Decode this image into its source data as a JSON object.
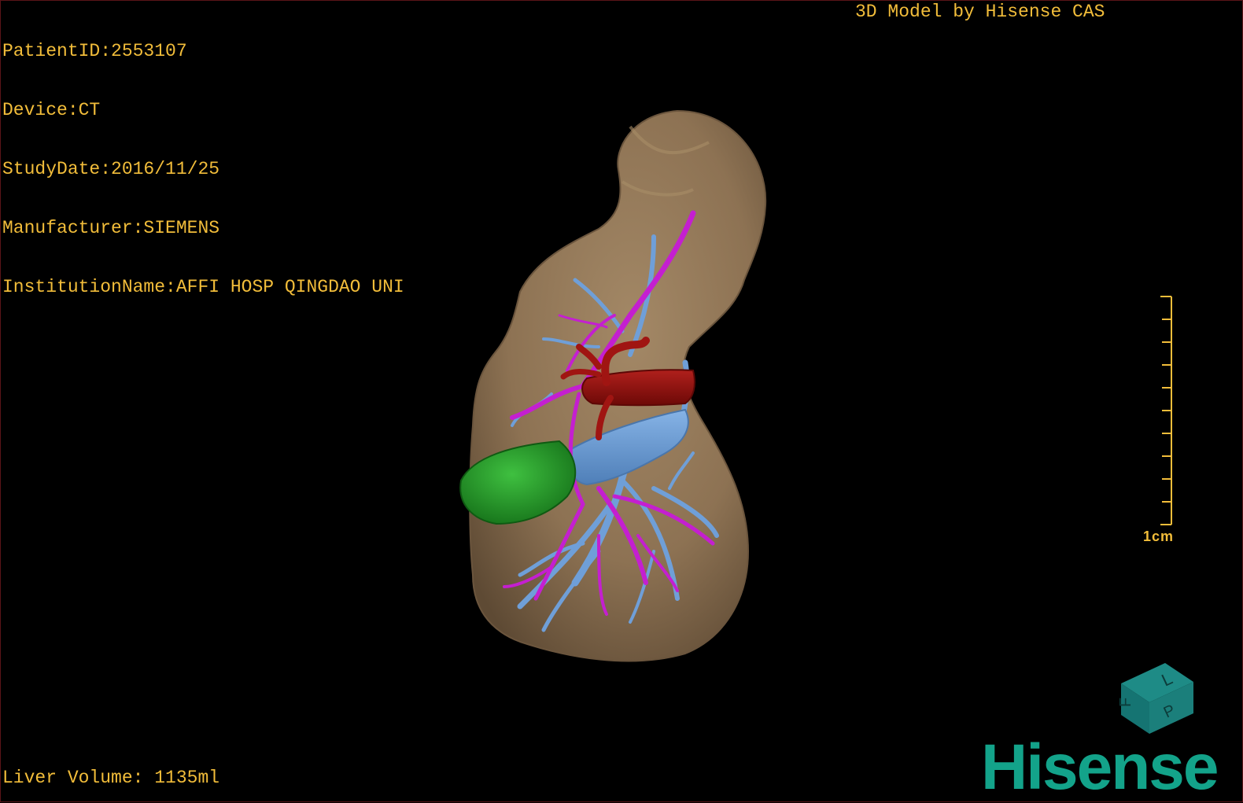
{
  "patient_info": {
    "patient_id": "PatientID:2553107",
    "device": "Device:CT",
    "study_date": "StudyDate:2016/11/25",
    "manufacturer": "Manufacturer:SIEMENS",
    "institution": "InstitutionName:AFFI HOSP QINGDAO UNI"
  },
  "credit": "3D Model by Hisense CAS",
  "liver_volume": "Liver Volume: 1135ml",
  "scale_bar": {
    "label": "1cm",
    "divisions": 10
  },
  "orientation_cube": {
    "face_letters": [
      "L",
      "F",
      "P"
    ]
  },
  "brand_logo": "Hisense",
  "colors": {
    "text": "#f2bd3a",
    "liver": "#8d7253",
    "portal_vein": "#6f9fd8",
    "hepatic_vein": "#c41fd0",
    "artery": "#8e0f0d",
    "gallbladder": "#1f9a24",
    "brand": "#13a38a"
  }
}
